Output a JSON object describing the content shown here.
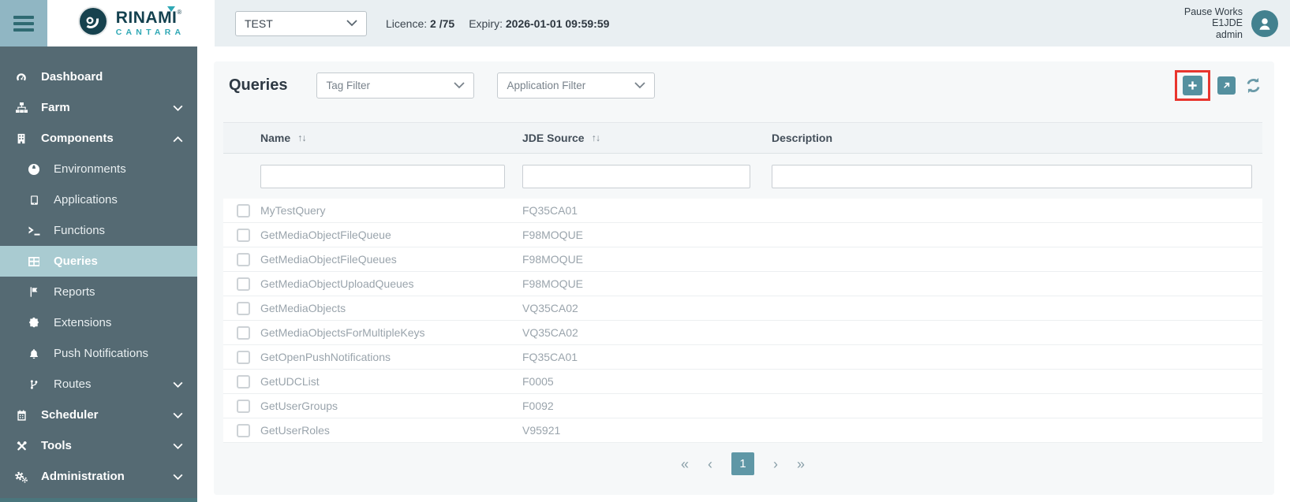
{
  "header": {
    "brand": {
      "name": "RINAMI",
      "registered": "®",
      "sub": "CANTARA"
    },
    "environment_select": {
      "selected": "TEST"
    },
    "licence": {
      "label": "Licence:",
      "value": "2 /75"
    },
    "expiry": {
      "label": "Expiry:",
      "value": "2026-01-01 09:59:59"
    },
    "user": {
      "line1": "Pause Works",
      "line2": "E1JDE",
      "line3": "admin"
    }
  },
  "sidebar": {
    "items": [
      {
        "label": "Dashboard"
      },
      {
        "label": "Farm"
      },
      {
        "label": "Components"
      },
      {
        "label": "Environments"
      },
      {
        "label": "Applications"
      },
      {
        "label": "Functions"
      },
      {
        "label": "Queries"
      },
      {
        "label": "Reports"
      },
      {
        "label": "Extensions"
      },
      {
        "label": "Push Notifications"
      },
      {
        "label": "Routes"
      },
      {
        "label": "Scheduler"
      },
      {
        "label": "Tools"
      },
      {
        "label": "Administration"
      }
    ]
  },
  "main": {
    "title": "Queries",
    "tag_filter": {
      "placeholder": "Tag Filter"
    },
    "application_filter": {
      "placeholder": "Application Filter"
    },
    "table": {
      "columns": {
        "name": "Name",
        "jde_source": "JDE Source",
        "description": "Description"
      },
      "sort_glyph": "↑↓",
      "rows": [
        {
          "name": "MyTestQuery",
          "jde_source": "FQ35CA01",
          "description": ""
        },
        {
          "name": "GetMediaObjectFileQueue",
          "jde_source": "F98MOQUE",
          "description": ""
        },
        {
          "name": "GetMediaObjectFileQueues",
          "jde_source": "F98MOQUE",
          "description": ""
        },
        {
          "name": "GetMediaObjectUploadQueues",
          "jde_source": "F98MOQUE",
          "description": ""
        },
        {
          "name": "GetMediaObjects",
          "jde_source": "VQ35CA02",
          "description": ""
        },
        {
          "name": "GetMediaObjectsForMultipleKeys",
          "jde_source": "VQ35CA02",
          "description": ""
        },
        {
          "name": "GetOpenPushNotifications",
          "jde_source": "FQ35CA01",
          "description": ""
        },
        {
          "name": "GetUDCList",
          "jde_source": "F0005",
          "description": ""
        },
        {
          "name": "GetUserGroups",
          "jde_source": "F0092",
          "description": ""
        },
        {
          "name": "GetUserRoles",
          "jde_source": "V95921",
          "description": ""
        }
      ]
    },
    "pagination": {
      "first": "«",
      "prev": "‹",
      "page": "1",
      "next": "›",
      "last": "»"
    }
  },
  "colors": {
    "accent_teal": "#54909f",
    "sidebar_background": "#556a73",
    "selected_item_background": "#a9cbd1",
    "header_background": "#e9eff2",
    "annotation_red": "#e8352e",
    "pagination_active": "#5f97a6"
  }
}
